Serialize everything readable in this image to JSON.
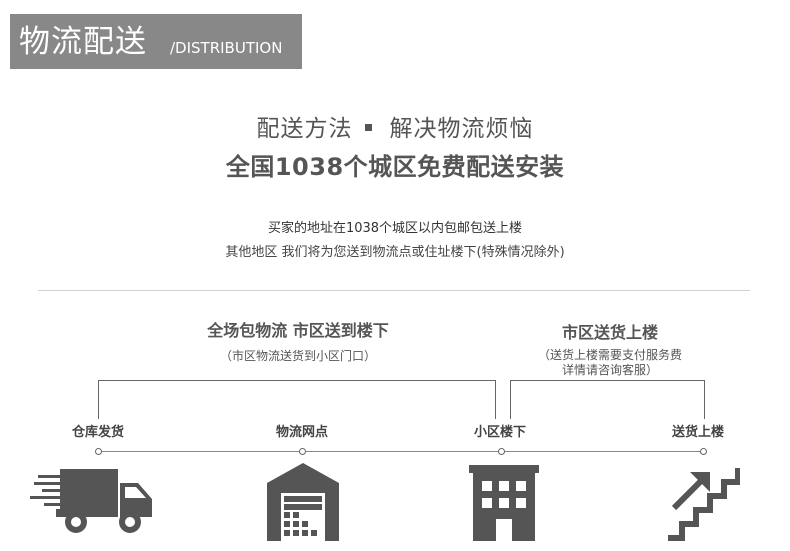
{
  "header": {
    "title": "物流配送",
    "subtitle": "/DISTRIBUTION"
  },
  "intro": {
    "method_left": "配送方法",
    "method_right": "解决物流烦恼",
    "headline": "全国1038个城区免费配送安装",
    "line1": "买家的地址在1038个城区以内包邮包送上楼",
    "line2": "其他地区 我们将为您送到物流点或住址楼下(特殊情况除外)"
  },
  "segments": {
    "left": {
      "title": "全场包物流 市区送到楼下",
      "note": "（市区物流送货到小区门口）"
    },
    "right": {
      "title": "市区送货上楼",
      "note_line1": "（送货上楼需要支付服务费",
      "note_line2": "详情请咨询客服）"
    }
  },
  "stages": [
    {
      "label": "仓库发货",
      "icon": "delivery-truck-icon"
    },
    {
      "label": "物流网点",
      "icon": "warehouse-icon"
    },
    {
      "label": "小区楼下",
      "icon": "building-icon"
    },
    {
      "label": "送货上楼",
      "icon": "stairs-up-icon"
    }
  ],
  "colors": {
    "header_bg": "#888888",
    "icon_fill": "#555555",
    "text": "#555555"
  }
}
